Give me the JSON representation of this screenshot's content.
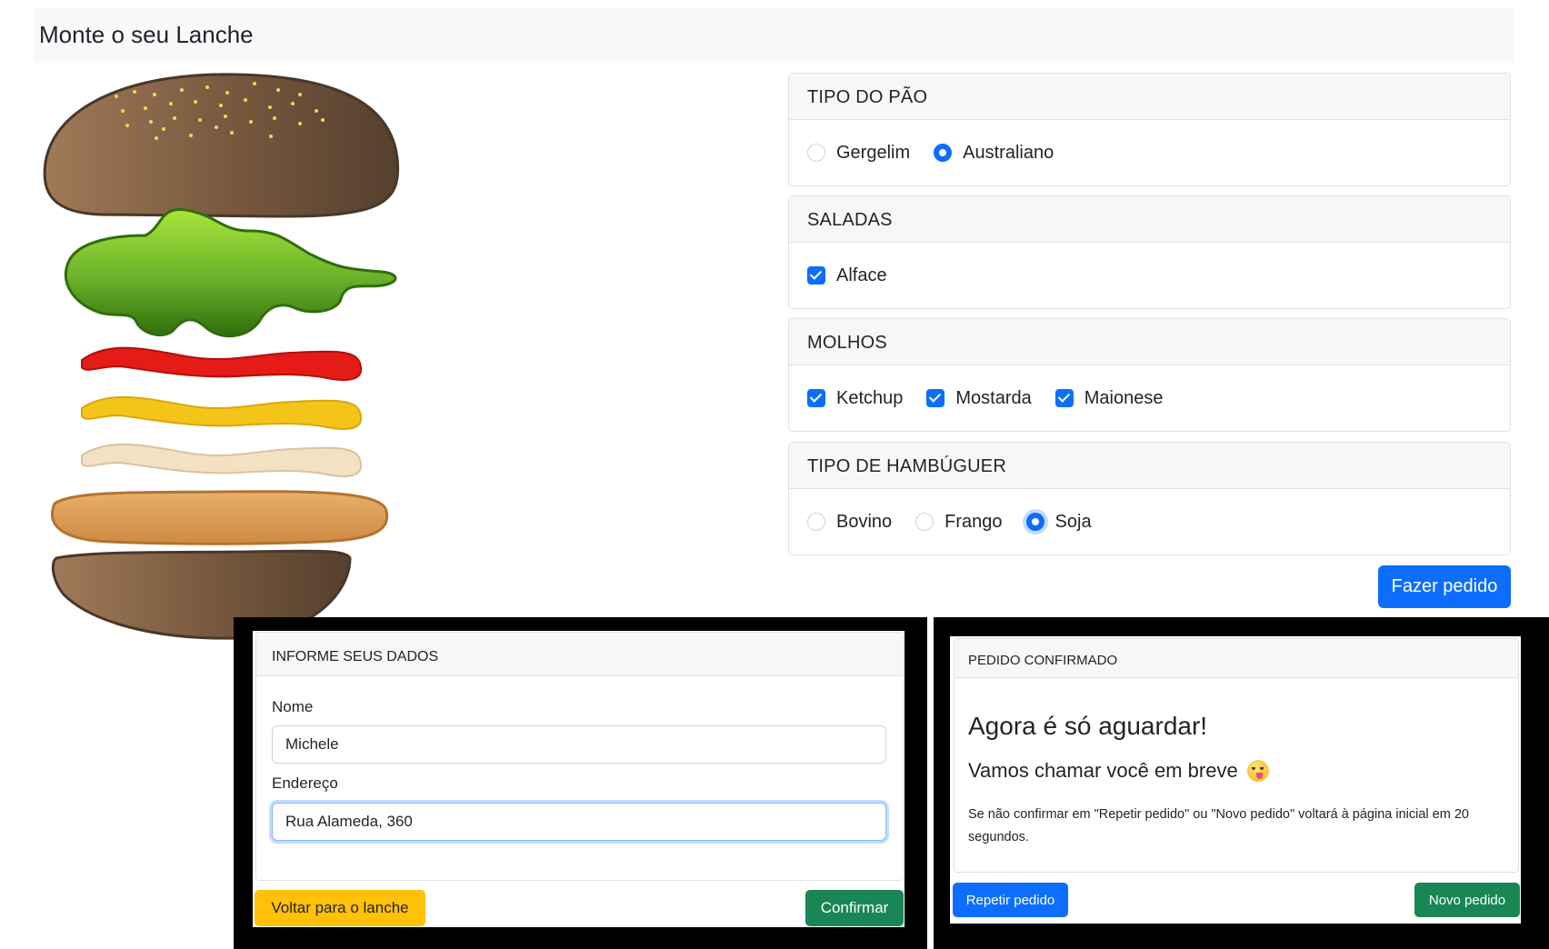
{
  "header": {
    "brand": "Monte o seu Lanche"
  },
  "illustration": {
    "name": "burger-illustration"
  },
  "options": {
    "bread": {
      "title": "TIPO DO PÃO",
      "items": [
        {
          "label": "Gergelim",
          "selected": false
        },
        {
          "label": "Australiano",
          "selected": true
        }
      ]
    },
    "salads": {
      "title": "SALADAS",
      "items": [
        {
          "label": "Alface",
          "checked": true
        }
      ]
    },
    "sauces": {
      "title": "MOLHOS",
      "items": [
        {
          "label": "Ketchup",
          "checked": true
        },
        {
          "label": "Mostarda",
          "checked": true
        },
        {
          "label": "Maionese",
          "checked": true
        }
      ]
    },
    "burger": {
      "title": "TIPO DE HAMBÚGUER",
      "items": [
        {
          "label": "Bovino",
          "selected": false
        },
        {
          "label": "Frango",
          "selected": false
        },
        {
          "label": "Soja",
          "selected": true
        }
      ]
    },
    "order_button": "Fazer pedido"
  },
  "customer_modal": {
    "title": "INFORME SEUS DADOS",
    "name_label": "Nome",
    "name_value": "Michele",
    "address_label": "Endereço",
    "address_value": "Rua Alameda, 360",
    "back_button": "Voltar para o lanche",
    "confirm_button": "Confirmar"
  },
  "confirmation_modal": {
    "title": "PEDIDO CONFIRMADO",
    "heading": "Agora é só aguardar!",
    "subheading": "Vamos chamar você em breve",
    "message": "Se não confirmar em \"Repetir pedido\" ou \"Novo pedido\" voltará à página inicial em 20 segundos.",
    "repeat_button": "Repetir pedido",
    "new_button": "Novo pedido"
  },
  "colors": {
    "primary": "#0d6efd",
    "success": "#198754",
    "warning": "#ffc107",
    "header_bg": "#f8f9fa"
  }
}
